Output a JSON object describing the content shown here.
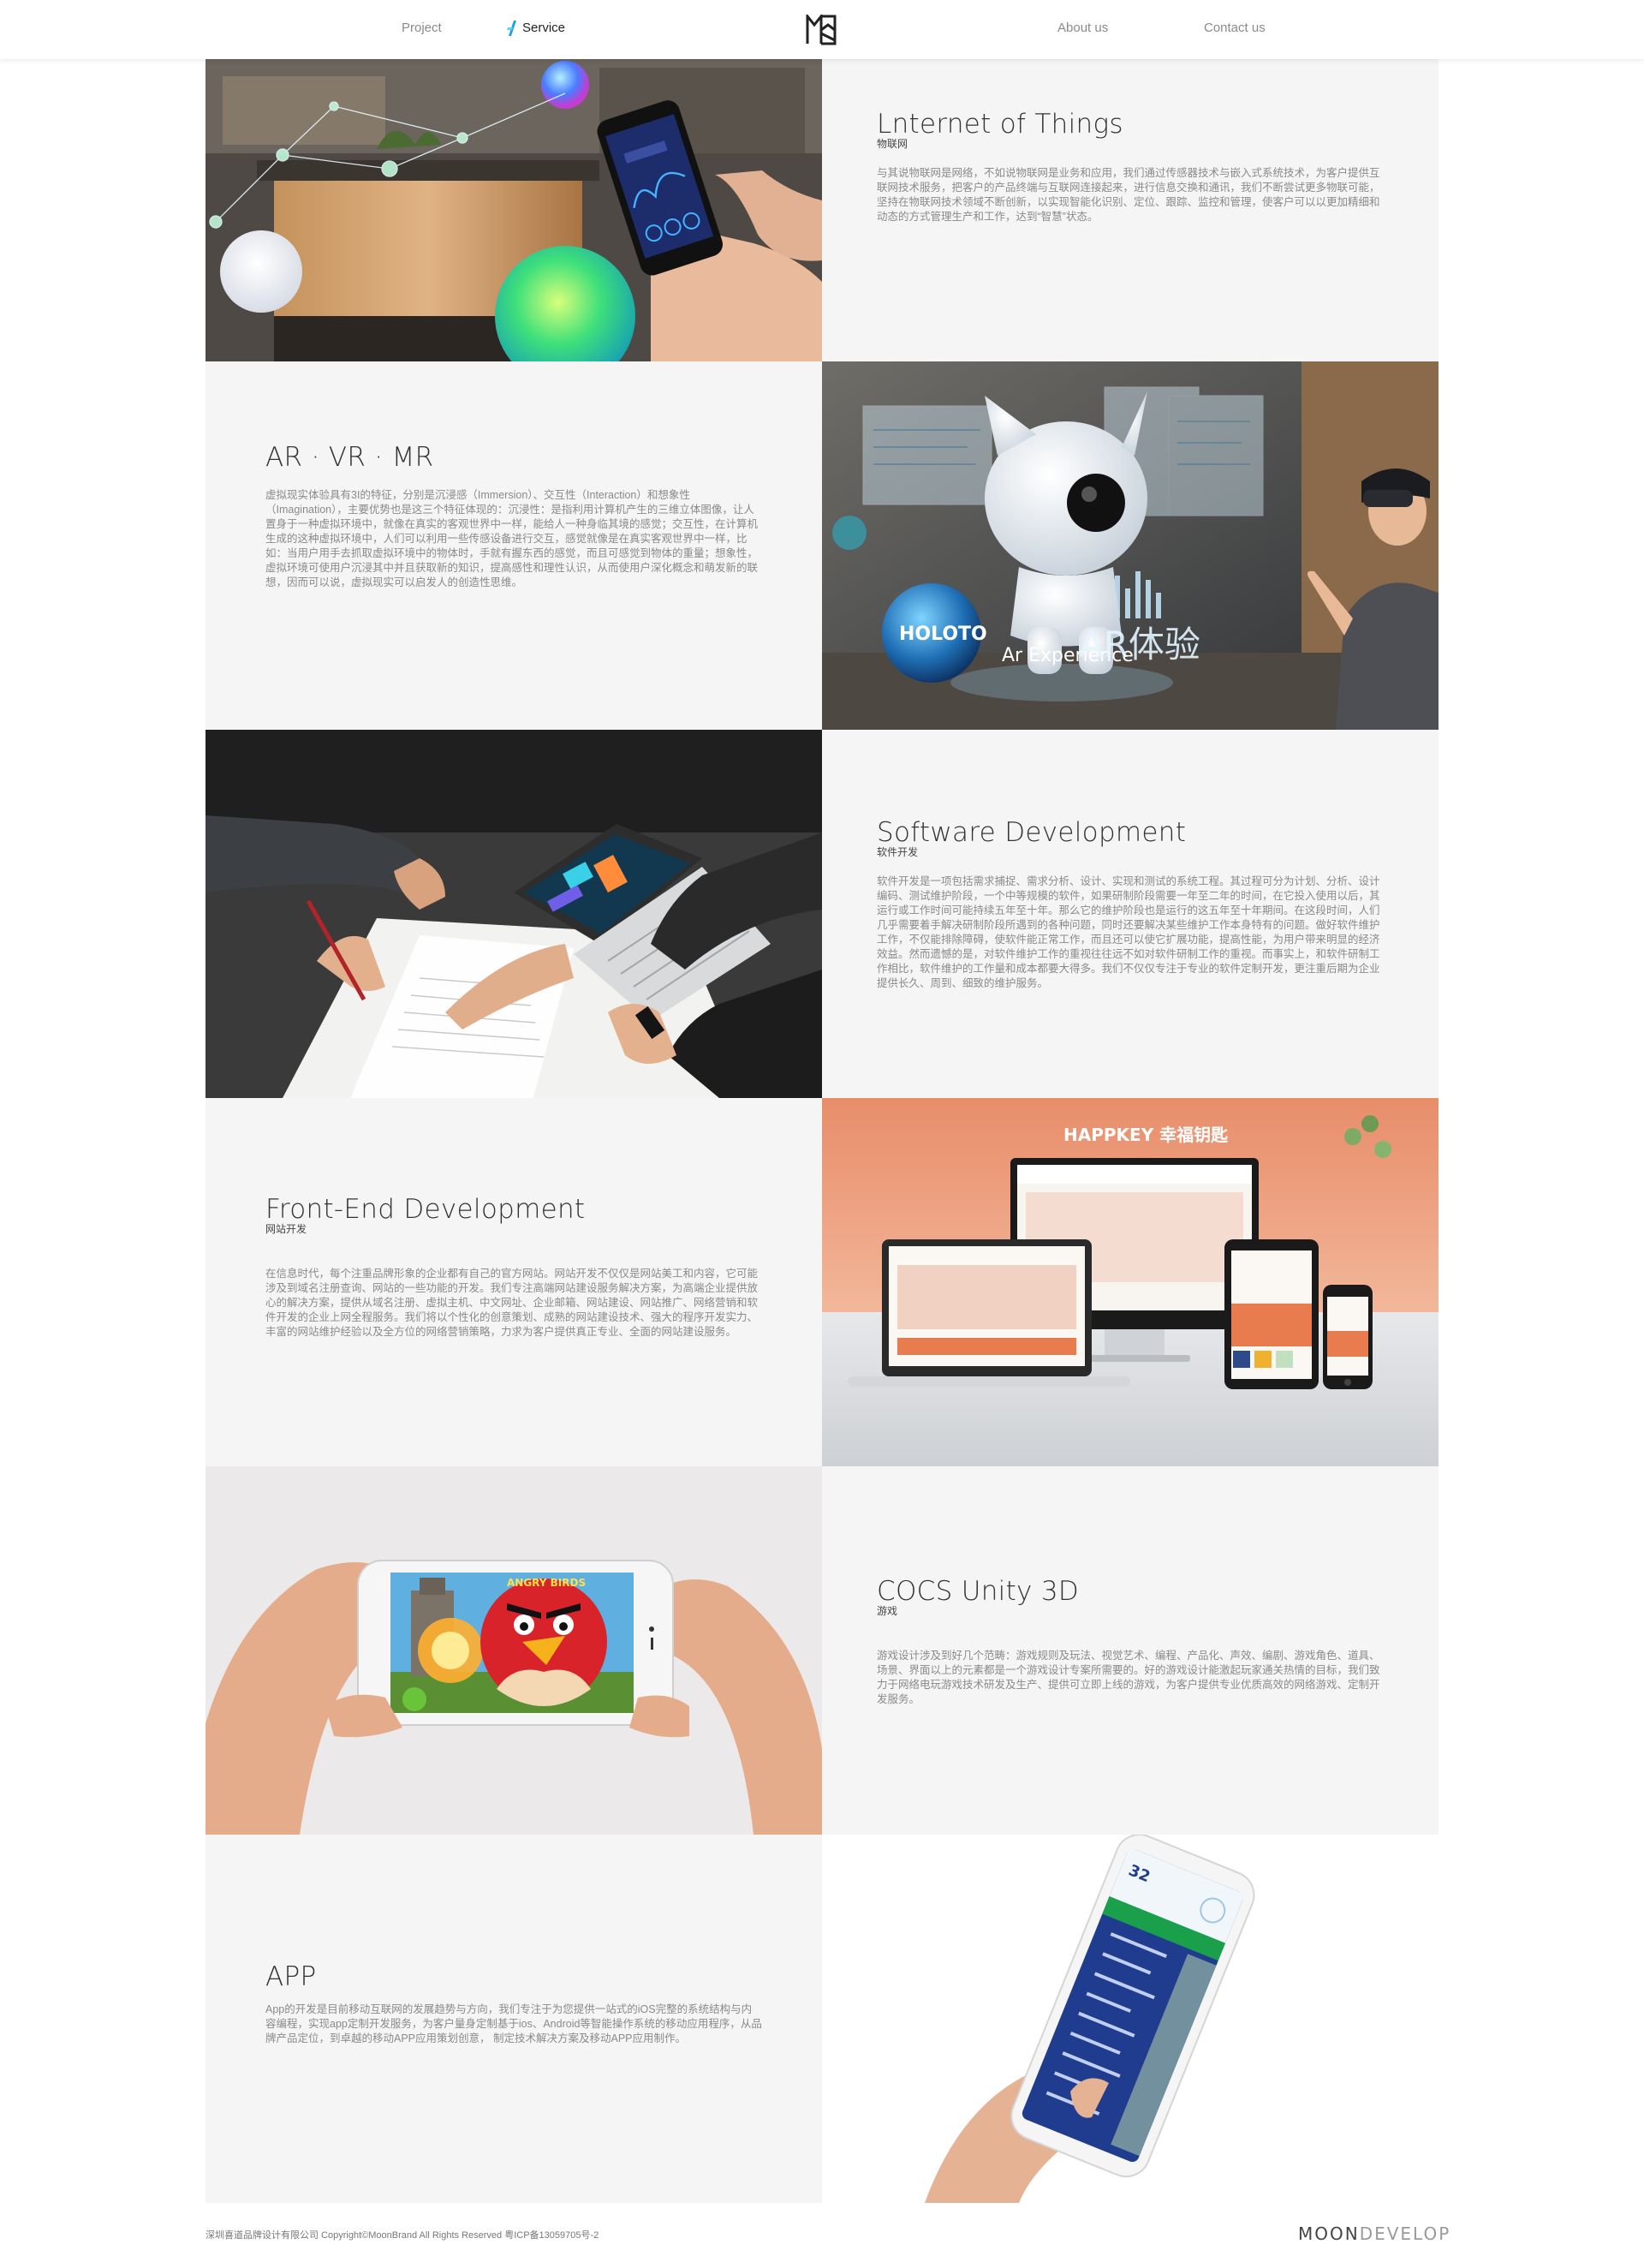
{
  "nav": {
    "project": "Project",
    "service": "Service",
    "about": "About us",
    "contact": "Contact us",
    "active_color": "#1aa0e8"
  },
  "sections": [
    {
      "title": "Lnternet of Things",
      "subtitle": "物联网",
      "description": "与其说物联网是网络，不如说物联网是业务和应用，我们通过传感器技术与嵌入式系统技术，为客户提供互联网技术服务，把客户的产品终端与互联网连接起来，进行信息交换和通讯，我们不断尝试更多物联可能，坚持在物联网技术领域不断创新，以实现智能化识别、定位、跟踪、监控和管理，使客户可以以更加精细和动态的方式管理生产和工作，达到“智慧”状态。",
      "image": "smart-home-phone-image"
    },
    {
      "title": "AR · VR · MR",
      "subtitle": "",
      "description": "虚拟现实体验具有3I的特征，分别是沉浸感（Immersion）、交互性（Interaction）和想象性（Imagination），主要优势也是这三个特征体现的：沉浸性：是指利用计算机产生的三维立体图像，让人置身于一种虚拟环境中，就像在真实的客观世界中一样，能给人一种身临其境的感觉；交互性，在计算机生成的这种虚拟环境中，人们可以利用一些传感设备进行交互，感觉就像是在真实客观世界中一样，比如：当用户用手去抓取虚拟环境中的物体时，手就有握东西的感觉，而且可感觉到物体的重量；想象性，虚拟环境可使用户沉浸其中并且获取新的知识，提高感性和理性认识，从而使用户深化概念和萌发新的联想，因而可以说，虚拟现实可以启发人的创造性思维。",
      "image": "ar-experience-image",
      "image_text_small": "Ar Experience",
      "image_text_big": "AR体验",
      "globe_text": "HOLOTO"
    },
    {
      "title": "Software Development",
      "subtitle": "软件开发",
      "description": "软件开发是一项包括需求捕捉、需求分析、设计、实现和测试的系统工程。其过程可分为计划、分析、设计编码、测试维护阶段，一个中等规模的软件，如果研制阶段需要一年至二年的时间，在它投入使用以后，其运行或工作时间可能持续五年至十年。那么它的维护阶段也是运行的这五年至十年期间。在这段时间，人们几乎需要着手解决研制阶段所遇到的各种问题，同时还要解决某些维护工作本身特有的问题。做好软件维护工作，不仅能排除障碍，使软件能正常工作，而且还可以使它扩展功能，提高性能，为用户带来明显的经济效益。然而遗憾的是，对软件维护工作的重视往往远不如对软件研制工作的重视。而事实上，和软件研制工作相比，软件维护的工作量和成本都要大得多。我们不仅仅专注于专业的软件定制开发，更注重后期为企业提供长久、周到、细致的维护服务。",
      "image": "laptop-desk-team-image"
    },
    {
      "title": "Front-End Development",
      "subtitle": "网站开发",
      "description": "在信息时代，每个注重品牌形象的企业都有自己的官方网站。网站开发不仅仅是网站美工和内容，它可能涉及到域名注册查询、网站的一些功能的开发。我们专注高端网站建设服务解决方案，为高端企业提供放心的解决方案，提供从域名注册、虚拟主机、中文网址、企业邮箱、网站建设、网站推广、网络营销和软件开发的企业上网全程服务。我们将以个性化的创意策划、成熟的网站建设技术、强大的程序开发实力、丰富的网站维护经验以及全方位的网络营销策略，力求为客户提供真正专业、全面的网站建设服务。",
      "image": "responsive-devices-image",
      "image_brand": "HAPPKEY 幸福钥匙"
    },
    {
      "title": "COCS Unity 3D",
      "subtitle": "游戏",
      "description": "游戏设计涉及到好几个范畴：游戏规则及玩法、视觉艺术、编程、产品化、声效、编剧、游戏角色、道具、场景、界面以上的元素都是一个游戏设计专案所需要的。好的游戏设计能激起玩家通关热情的目标，我们致力于网络电玩游戏技术研发及生产、提供可立即上线的游戏，为客户提供专业优质高效的网络游戏、定制开发服务。",
      "image": "mobile-game-image",
      "game_title": "ANGRY BIRDS"
    },
    {
      "title": "APP",
      "subtitle": "",
      "description": "App的开发是目前移动互联网的发展趋势与方向，我们专注于为您提供一站式的iOS完整的系统结构与内容编程，实现app定制开发服务，为客户量身定制基于ios、Android等智能操作系统的移动应用程序，从品牌产品定位，到卓越的移动APP应用策划创意， 制定技术解决方案及移动APP应用制作。",
      "image": "app-phone-image",
      "app_temp": "32"
    }
  ],
  "footer": {
    "copyright": "深圳喜道品牌设计有限公司 Copyright©MoonBrand All Rights Reserved    粤ICP备13059705号-2",
    "brand_main": "MOON",
    "brand_sub": "DEVELOP"
  }
}
